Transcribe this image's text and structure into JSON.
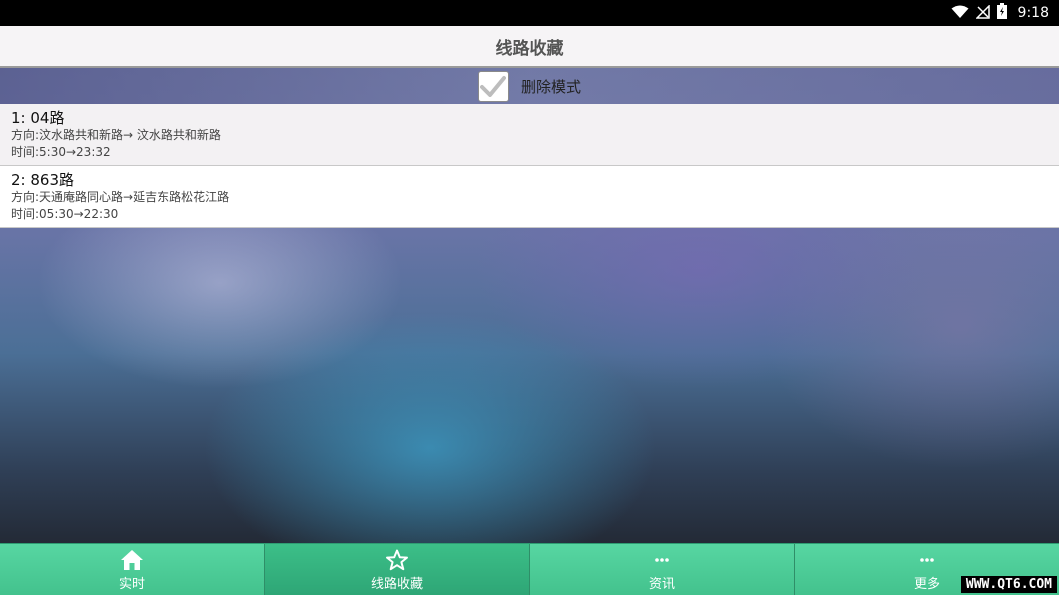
{
  "status_bar": {
    "time": "9:18"
  },
  "title_bar": {
    "title": "线路收藏"
  },
  "delete_mode": {
    "label": "删除模式",
    "checked": true
  },
  "routes": [
    {
      "name": "1:  04路",
      "direction": "方向:汶水路共和新路→ 汶水路共和新路",
      "time": "时间:5:30→23:32"
    },
    {
      "name": "2:  863路",
      "direction": "方向:天通庵路同心路→延吉东路松花江路",
      "time": "时间:05:30→22:30"
    }
  ],
  "tabs": [
    {
      "label": "实时",
      "icon": "home-icon",
      "active": false
    },
    {
      "label": "线路收藏",
      "icon": "star-icon",
      "active": true
    },
    {
      "label": "资讯",
      "icon": "dots-icon",
      "active": false
    },
    {
      "label": "更多",
      "icon": "dots-icon",
      "active": false
    }
  ],
  "watermark": "WWW.QT6.COM",
  "colors": {
    "tab_green": "#4ccb96",
    "tab_active": "#35b17f",
    "title_bg": "#f6f4f6"
  }
}
